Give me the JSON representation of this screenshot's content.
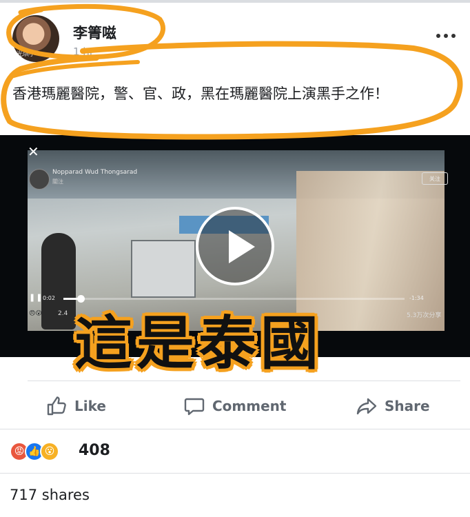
{
  "post": {
    "author": "李箐嗞",
    "timestamp": "1 hr",
    "avatar_caption": "光琪小",
    "text": "香港瑪麗醫院，警、官、政，黑在瑪麗醫院上演黑手之作！"
  },
  "video": {
    "channel_name": "Nopparad Wud Thongsarad",
    "channel_sub": "關注",
    "follow_label": "关注",
    "elapsed": "0:02",
    "remaining": "-1:34",
    "progress": 0.05,
    "reactions_count": "2.4",
    "shares_text": "5.3万次分享",
    "overlay_caption": "這是泰國"
  },
  "actions": {
    "like_label": "Like",
    "comment_label": "Comment",
    "share_label": "Share"
  },
  "stats": {
    "reaction_icons": [
      "angry-reaction",
      "like-reaction",
      "wow-reaction"
    ],
    "reaction_count": "408",
    "shares": "717 shares"
  },
  "colors": {
    "highlight": "#f5a11f",
    "text": "#1c1e21",
    "muted": "#606770",
    "like_blue": "#1877f2",
    "angry_red": "#e9573e"
  }
}
